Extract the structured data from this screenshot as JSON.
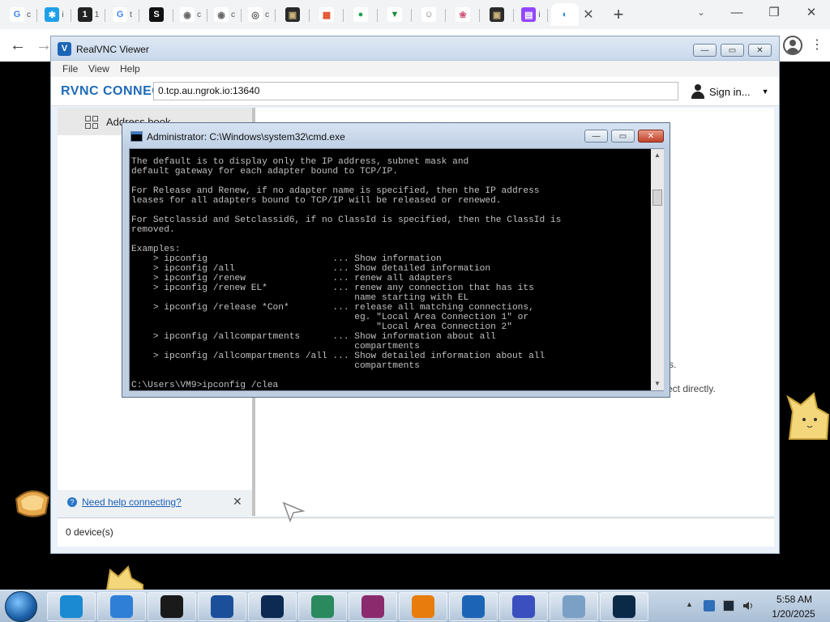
{
  "browser": {
    "tabs": [
      {
        "icon": "google-icon",
        "glyph": "G",
        "color": "#4285f4",
        "bg": "#ffffff",
        "fragment": "c"
      },
      {
        "icon": "shield-icon",
        "glyph": "✱",
        "color": "#ffffff",
        "bg": "#1ea0e8",
        "fragment": "i"
      },
      {
        "icon": "number-one-icon",
        "glyph": "1",
        "color": "#ffffff",
        "bg": "#222222",
        "fragment": "1"
      },
      {
        "icon": "google-icon",
        "glyph": "G",
        "color": "#4285f4",
        "bg": "#ffffff",
        "fragment": "t"
      },
      {
        "icon": "s-logo-icon",
        "glyph": "S",
        "color": "#ffffff",
        "bg": "#111111",
        "fragment": ""
      },
      {
        "icon": "globe-icon",
        "glyph": "◉",
        "color": "#666666",
        "bg": "#ffffff",
        "fragment": "c"
      },
      {
        "icon": "globe-icon",
        "glyph": "◉",
        "color": "#666666",
        "bg": "#ffffff",
        "fragment": "c"
      },
      {
        "icon": "chrome-icon",
        "glyph": "◎",
        "color": "#555555",
        "bg": "#ffffff",
        "fragment": "c"
      },
      {
        "icon": "image-thumb-icon",
        "glyph": "▣",
        "color": "#c8b27a",
        "bg": "#2a2a2a",
        "fragment": ""
      },
      {
        "icon": "windows-logo-icon",
        "glyph": "▦",
        "color": "#e24b27",
        "bg": "#ffffff",
        "fragment": ""
      },
      {
        "icon": "green-logo-icon",
        "glyph": "●",
        "color": "#1aa34a",
        "bg": "#ffffff",
        "fragment": ""
      },
      {
        "icon": "green-head-icon",
        "glyph": "▼",
        "color": "#1a8a3a",
        "bg": "#ffffff",
        "fragment": ""
      },
      {
        "icon": "face-icon",
        "glyph": "☺",
        "color": "#777777",
        "bg": "#ffffff",
        "fragment": ""
      },
      {
        "icon": "swirl-icon",
        "glyph": "❀",
        "color": "#d2547a",
        "bg": "#ffffff",
        "fragment": ""
      },
      {
        "icon": "image-thumb-icon",
        "glyph": "▣",
        "color": "#c8b27a",
        "bg": "#2a2a2a",
        "fragment": ""
      },
      {
        "icon": "twitch-icon",
        "glyph": "▤",
        "color": "#ffffff",
        "bg": "#9146ff",
        "fragment": "i"
      },
      {
        "icon": "edge-icon",
        "glyph": "◐",
        "color": "#1e88d6",
        "bg": "#ffffff",
        "fragment": "",
        "active": true
      }
    ],
    "close_tab": "✕",
    "new_tab": "+",
    "tab_search": "⌄",
    "minimize": "—",
    "restore": "❐",
    "close": "✕",
    "back": "←",
    "forward": "→",
    "menu": "⋮"
  },
  "vnc": {
    "title": "RealVNC Viewer",
    "menus": [
      "File",
      "View",
      "Help"
    ],
    "brand": "RVNC CONNECT",
    "address": "0.tcp.au.ngrok.io:13640",
    "signin": "Sign in...",
    "signin_caret": "▼",
    "sidebar_item": "Address book",
    "help_link": "Need help connecting?",
    "help_close": "✕",
    "main_fragment_1": "s.",
    "main_fragment_2": "ect directly.",
    "status": "0 device(s)",
    "btn_min": "—",
    "btn_max": "▭",
    "btn_close": "✕"
  },
  "cmd": {
    "title": "Administrator: C:\\Windows\\system32\\cmd.exe",
    "lines": [
      "The default is to display only the IP address, subnet mask and",
      "default gateway for each adapter bound to TCP/IP.",
      "",
      "For Release and Renew, if no adapter name is specified, then the IP address",
      "leases for all adapters bound to TCP/IP will be released or renewed.",
      "",
      "For Setclassid and Setclassid6, if no ClassId is specified, then the ClassId is",
      "removed.",
      "",
      "Examples:",
      "    > ipconfig                       ... Show information",
      "    > ipconfig /all                  ... Show detailed information",
      "    > ipconfig /renew                ... renew all adapters",
      "    > ipconfig /renew EL*            ... renew any connection that has its",
      "                                         name starting with EL",
      "    > ipconfig /release *Con*        ... release all matching connections,",
      "                                         eg. \"Local Area Connection 1\" or",
      "                                             \"Local Area Connection 2\"",
      "    > ipconfig /allcompartments      ... Show information about all",
      "                                         compartments",
      "    > ipconfig /allcompartments /all ... Show detailed information about all",
      "                                         compartments",
      "",
      "C:\\Users\\VM9>ipconfig /clea"
    ],
    "btn_min": "—",
    "btn_max": "▭",
    "btn_close": "✕",
    "scroll_up": "▲",
    "scroll_down": "▼"
  },
  "taskbar": {
    "apps": [
      {
        "name": "taskbar-app-edge-legacy",
        "color": "#1b8ad3"
      },
      {
        "name": "taskbar-app-internet-explorer",
        "color": "#2f7fd6"
      },
      {
        "name": "taskbar-app-black-box",
        "color": "#1a1a1a"
      },
      {
        "name": "taskbar-app-media-player",
        "color": "#1c4f9a"
      },
      {
        "name": "taskbar-app-dark-globe",
        "color": "#0d2a52"
      },
      {
        "name": "taskbar-app-network-globe",
        "color": "#2a8a5e"
      },
      {
        "name": "taskbar-app-winrar",
        "color": "#8b2b6e"
      },
      {
        "name": "taskbar-app-blender",
        "color": "#e87d0d"
      },
      {
        "name": "taskbar-app-realvnc",
        "color": "#1c65b6"
      },
      {
        "name": "taskbar-app-bird",
        "color": "#3b4fbf"
      },
      {
        "name": "taskbar-app-recycle",
        "color": "#7aa0c6"
      },
      {
        "name": "taskbar-app-terminal",
        "color": "#0b2a48"
      }
    ],
    "time": "5:58 AM",
    "date": "1/20/2025",
    "tray_arrow": "▲"
  }
}
